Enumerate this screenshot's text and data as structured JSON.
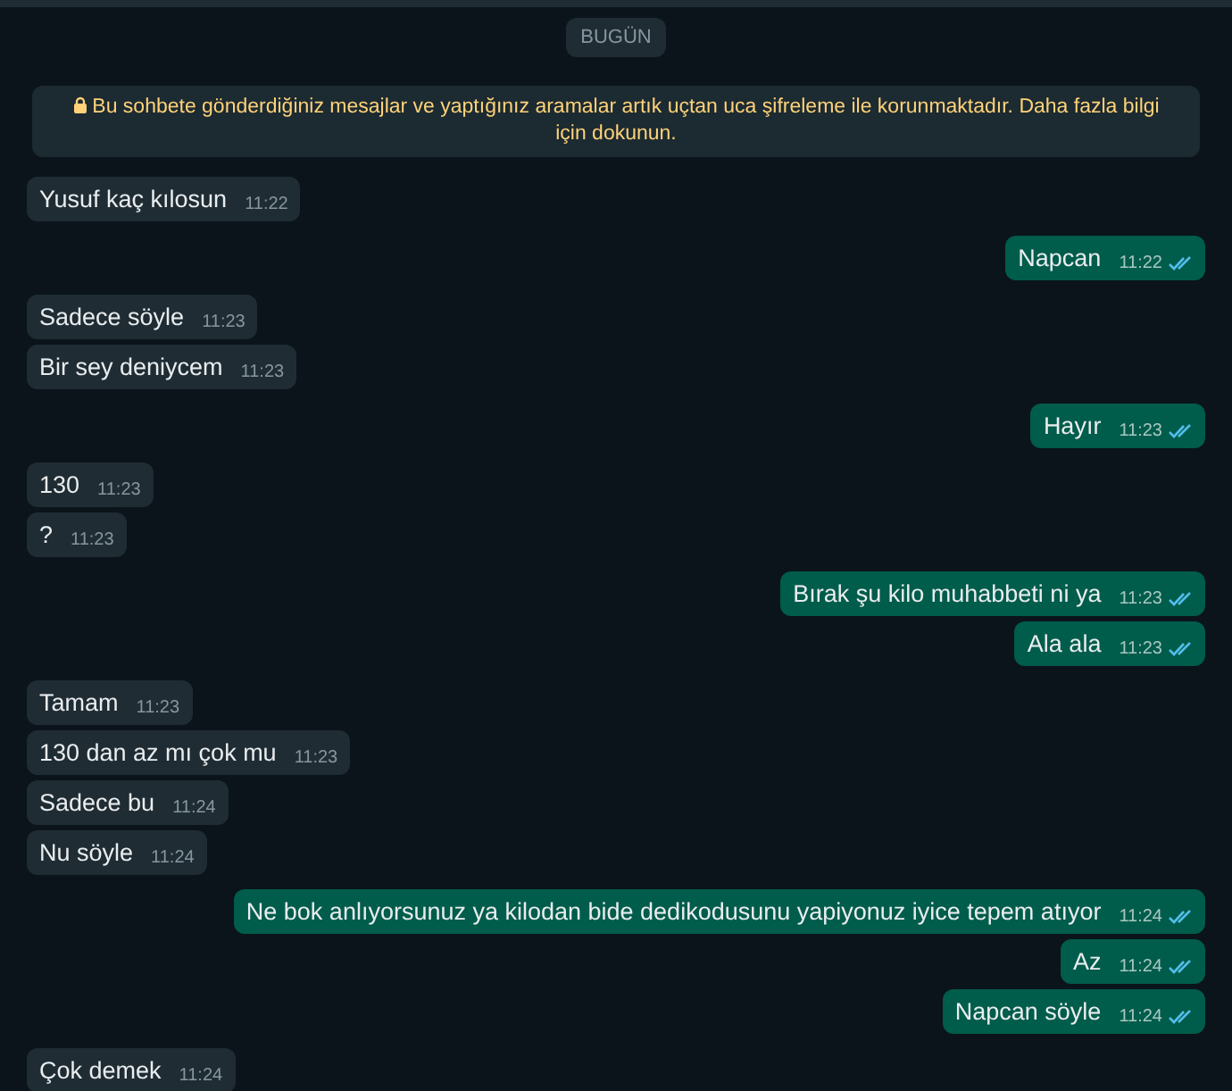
{
  "date_chip": "BUGÜN",
  "encryption_notice": "Bu sohbete gönderdiğiniz mesajlar ve yaptığınız aramalar artık uçtan uca şifreleme ile korunmaktadır. Daha fazla bilgi için dokunun.",
  "messages": [
    {
      "kind": "incoming",
      "text": "Yusuf kaç kılosun",
      "time": "11:22"
    },
    {
      "kind": "outgoing",
      "text": "Napcan",
      "time": "11:22",
      "read": true
    },
    {
      "kind": "incoming",
      "text": "Sadece söyle",
      "time": "11:23"
    },
    {
      "kind": "incoming",
      "text": "Bir sey deniycem",
      "time": "11:23"
    },
    {
      "kind": "outgoing",
      "text": "Hayır",
      "time": "11:23",
      "read": true
    },
    {
      "kind": "incoming",
      "text": "130",
      "time": "11:23"
    },
    {
      "kind": "incoming",
      "text": "?",
      "time": "11:23"
    },
    {
      "kind": "outgoing",
      "text": "Bırak şu kilo muhabbeti ni ya",
      "time": "11:23",
      "read": true
    },
    {
      "kind": "outgoing",
      "text": "Ala ala",
      "time": "11:23",
      "read": true
    },
    {
      "kind": "incoming",
      "text": "Tamam",
      "time": "11:23"
    },
    {
      "kind": "incoming",
      "text": "130 dan az mı çok mu",
      "time": "11:23"
    },
    {
      "kind": "incoming",
      "text": "Sadece bu",
      "time": "11:24"
    },
    {
      "kind": "incoming",
      "text": "Nu söyle",
      "time": "11:24"
    },
    {
      "kind": "outgoing",
      "text": "Ne bok anlıyorsunuz ya kilodan bide dedikodusunu yapiyonuz iyice tepem atıyor",
      "time": "11:24",
      "read": true
    },
    {
      "kind": "outgoing",
      "text": "Az",
      "time": "11:24",
      "read": true
    },
    {
      "kind": "outgoing",
      "text": "Napcan söyle",
      "time": "11:24",
      "read": true
    },
    {
      "kind": "incoming",
      "text": "Çok demek",
      "time": "11:24"
    }
  ]
}
